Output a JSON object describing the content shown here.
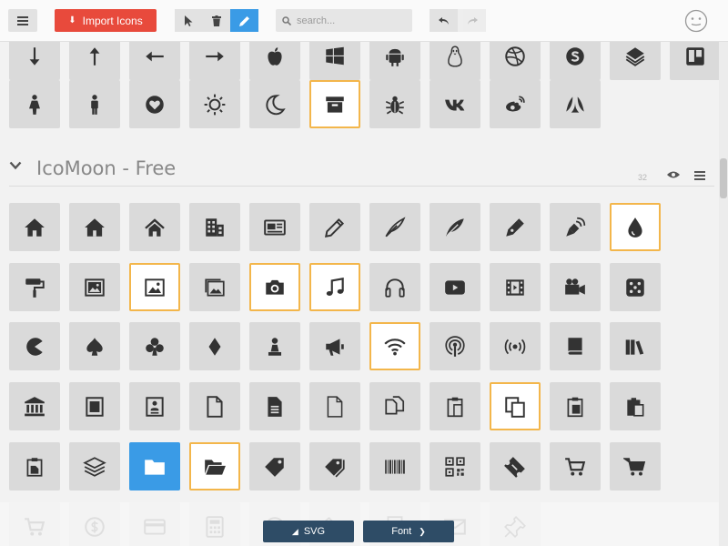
{
  "toolbar": {
    "import_label": "Import Icons",
    "search_placeholder": "search..."
  },
  "set": {
    "title": "IcoMoon - Free",
    "count": "32"
  },
  "footer": {
    "svg_label": "SVG",
    "font_label": "Font"
  },
  "colors": {
    "accent": "#3a9be6",
    "import": "#e84a3c",
    "selected_border": "#f3b64b",
    "footer_button": "#2e4c66"
  },
  "rows": [
    [
      "arrow-down",
      "arrow-up",
      "arrow-left",
      "arrow-right",
      "apple",
      "windows",
      "android",
      "linux",
      "dribbble",
      "skype",
      "foursquare",
      "trello"
    ],
    [
      "female",
      "male",
      "heart-circle",
      "sun",
      "moon",
      "archive",
      "bug",
      "vk",
      "weibo",
      "renren"
    ],
    [
      "home",
      "home2",
      "home3",
      "office",
      "newspaper",
      "pencil",
      "quill",
      "feather",
      "pen",
      "podcast-pen",
      "droplet"
    ],
    [
      "paint-roller",
      "image",
      "picture",
      "images",
      "camera",
      "music",
      "headphones",
      "play",
      "film",
      "video-camera",
      "dice"
    ],
    [
      "pacman",
      "spades",
      "clubs",
      "diamonds",
      "pawn",
      "bullhorn",
      "wifi",
      "podcast",
      "feed",
      "book",
      "books"
    ],
    [
      "library",
      "file-text",
      "profile",
      "file-empty",
      "file-text2",
      "file-blank",
      "files-empty",
      "paste",
      "copy",
      "paste2",
      "paste3"
    ],
    [
      "clipboard-stack",
      "stack",
      "folder",
      "folder-open",
      "price-tag",
      "price-tags",
      "barcode",
      "qrcode",
      "ticket",
      "cart",
      "cart2"
    ],
    [
      "cart3",
      "coin-dollar",
      "credit-card",
      "calculator",
      "lifebuoy",
      "phone",
      "address-book",
      "envelop",
      "pushpin"
    ]
  ],
  "selected": [
    "archive",
    "droplet",
    "picture",
    "camera",
    "music",
    "wifi",
    "copy",
    "folder-open"
  ],
  "active": [
    "folder"
  ]
}
